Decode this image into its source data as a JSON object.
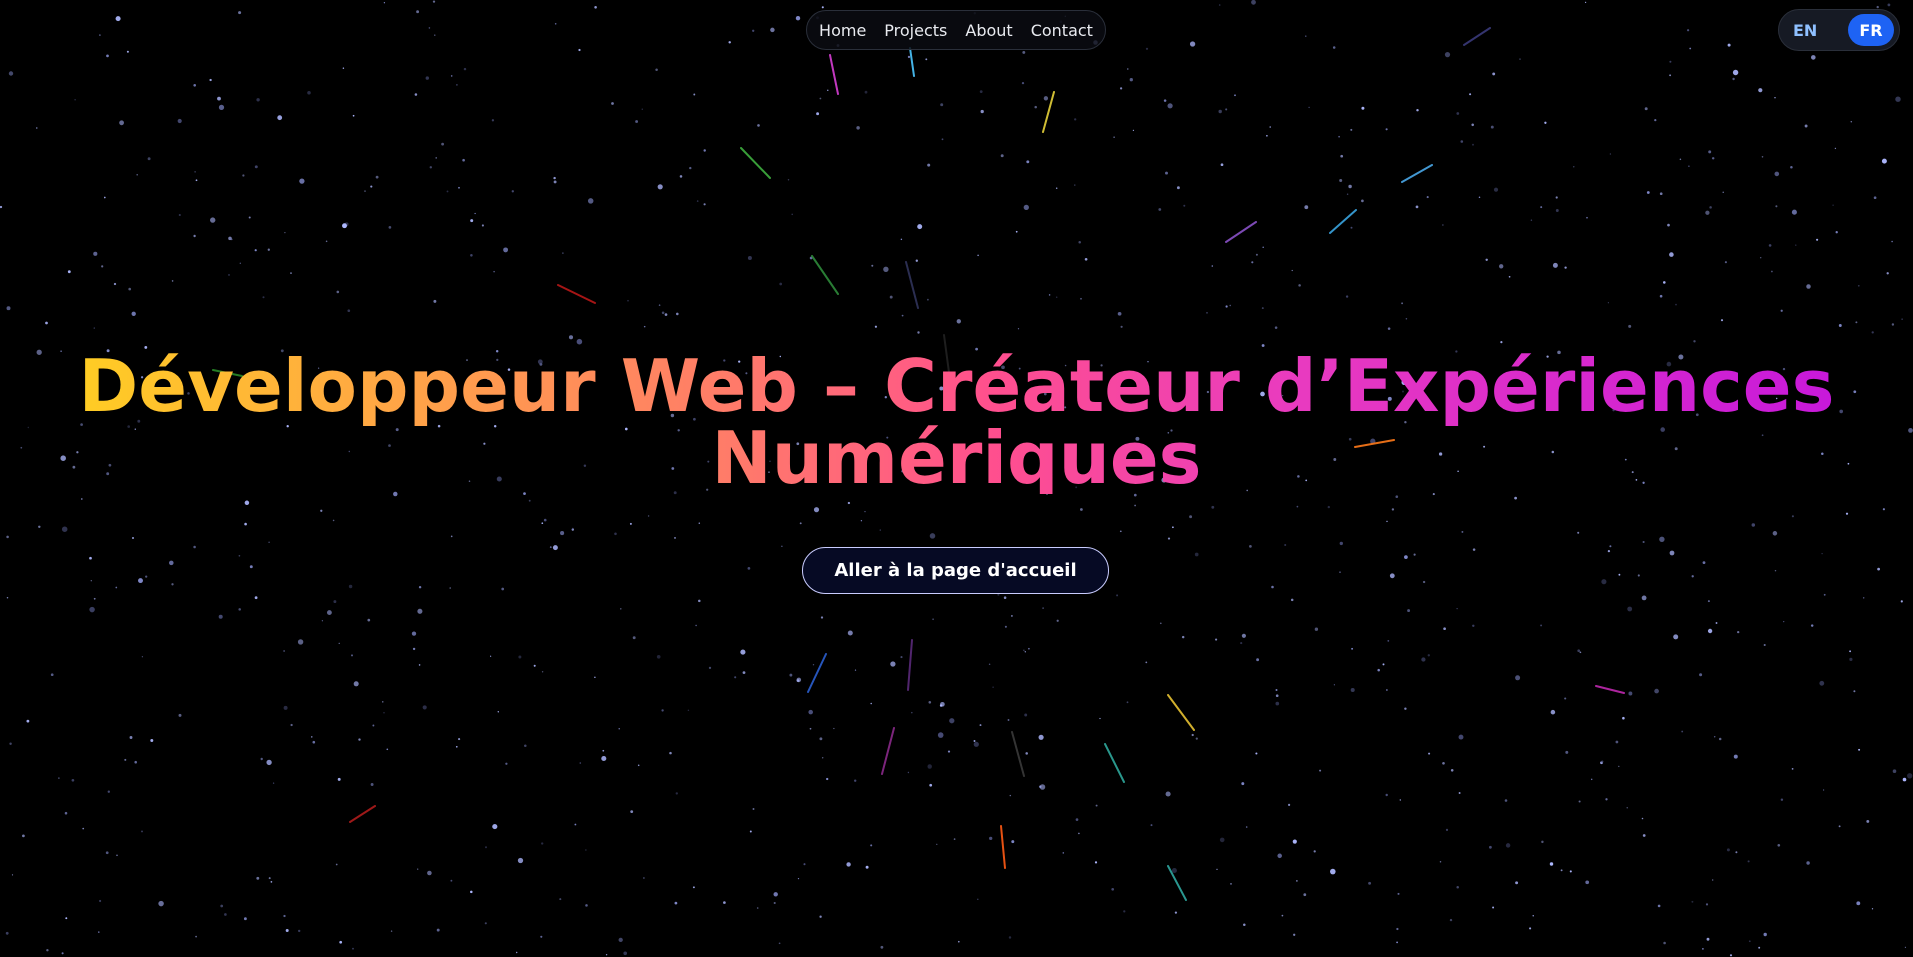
{
  "nav": {
    "items": [
      {
        "label": "Home"
      },
      {
        "label": "Projects"
      },
      {
        "label": "About"
      },
      {
        "label": "Contact"
      }
    ]
  },
  "language": {
    "options": [
      "EN",
      "FR"
    ],
    "selected": "FR"
  },
  "hero": {
    "title": "Développeur Web – Créateur d’Expériences Numériques",
    "cta_label": "Aller à la page d'accueil"
  },
  "colors": {
    "background": "#000000",
    "accent_blue": "#1e63f4",
    "title_gradient": [
      "#ffd21f",
      "#ff7a6a",
      "#ff4f8e",
      "#e93bbf",
      "#c516dc"
    ]
  }
}
